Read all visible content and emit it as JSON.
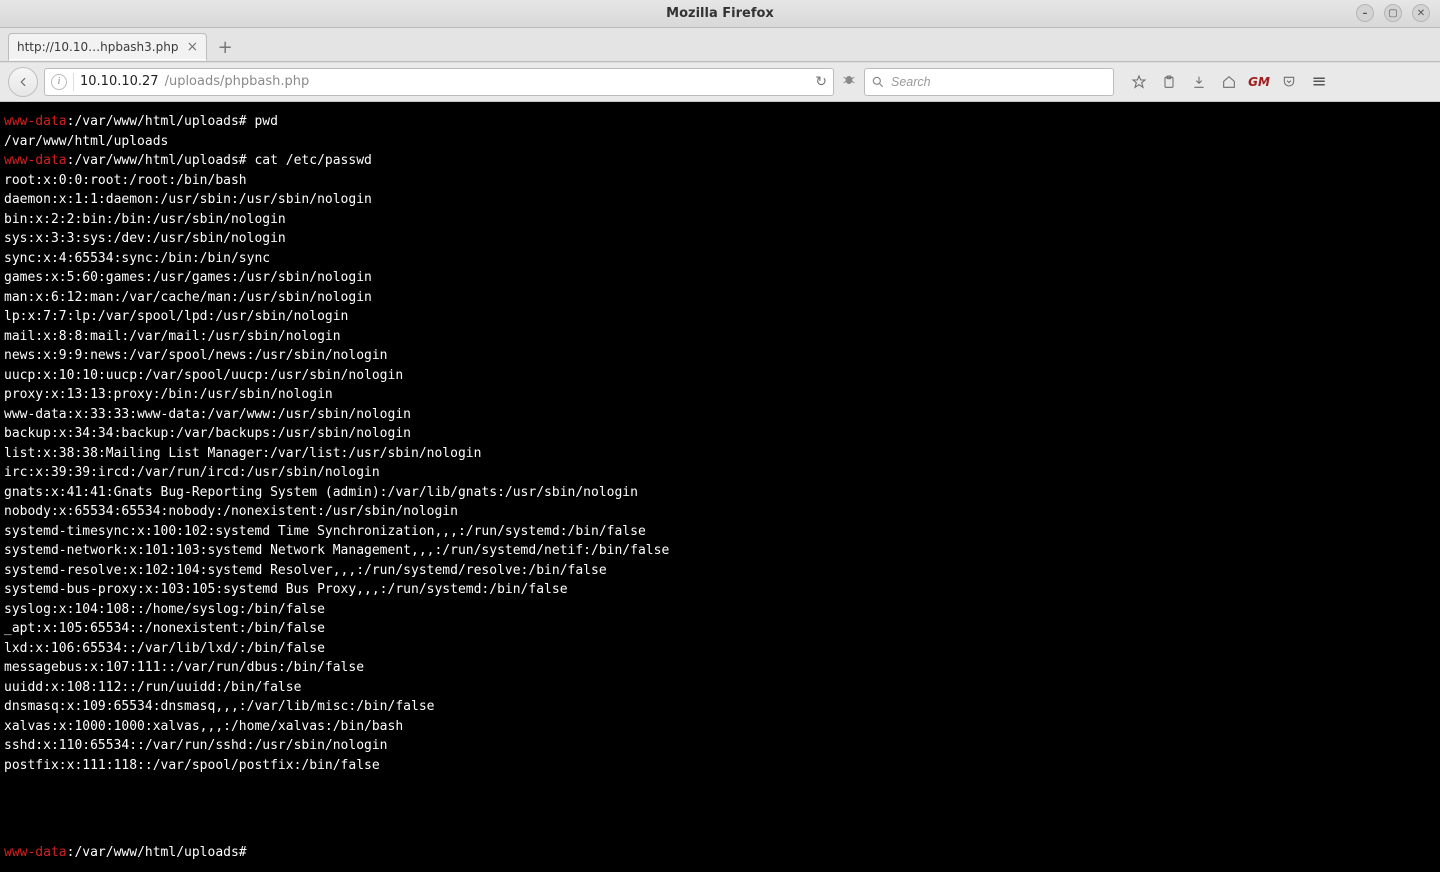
{
  "window": {
    "title": "Mozilla Firefox",
    "controls": {
      "min": "–",
      "max": "▢",
      "close": "✕"
    }
  },
  "tab": {
    "label": "http://10.10…hpbash3.php",
    "close_glyph": "×",
    "newtab_glyph": "+"
  },
  "nav": {
    "back_glyph": "←",
    "identity_glyph": "i",
    "url_host": "10.10.10.27",
    "url_path": "/uploads/phpbash.php",
    "reload_glyph": "↻",
    "bug_glyph": "🐞"
  },
  "search": {
    "placeholder": "Search",
    "value": ""
  },
  "toolbar": {
    "gm_label": "GM",
    "hamburger_glyph": "≡"
  },
  "terminal": {
    "user": "www-data",
    "cwd": "/var/www/html/uploads",
    "prompt_suffix": "#",
    "history": [
      {
        "cmd": "pwd",
        "output": [
          "/var/www/html/uploads"
        ]
      },
      {
        "cmd": "cat /etc/passwd",
        "output": [
          "root:x:0:0:root:/root:/bin/bash",
          "daemon:x:1:1:daemon:/usr/sbin:/usr/sbin/nologin",
          "bin:x:2:2:bin:/bin:/usr/sbin/nologin",
          "sys:x:3:3:sys:/dev:/usr/sbin/nologin",
          "sync:x:4:65534:sync:/bin:/bin/sync",
          "games:x:5:60:games:/usr/games:/usr/sbin/nologin",
          "man:x:6:12:man:/var/cache/man:/usr/sbin/nologin",
          "lp:x:7:7:lp:/var/spool/lpd:/usr/sbin/nologin",
          "mail:x:8:8:mail:/var/mail:/usr/sbin/nologin",
          "news:x:9:9:news:/var/spool/news:/usr/sbin/nologin",
          "uucp:x:10:10:uucp:/var/spool/uucp:/usr/sbin/nologin",
          "proxy:x:13:13:proxy:/bin:/usr/sbin/nologin",
          "www-data:x:33:33:www-data:/var/www:/usr/sbin/nologin",
          "backup:x:34:34:backup:/var/backups:/usr/sbin/nologin",
          "list:x:38:38:Mailing List Manager:/var/list:/usr/sbin/nologin",
          "irc:x:39:39:ircd:/var/run/ircd:/usr/sbin/nologin",
          "gnats:x:41:41:Gnats Bug-Reporting System (admin):/var/lib/gnats:/usr/sbin/nologin",
          "nobody:x:65534:65534:nobody:/nonexistent:/usr/sbin/nologin",
          "systemd-timesync:x:100:102:systemd Time Synchronization,,,:/run/systemd:/bin/false",
          "systemd-network:x:101:103:systemd Network Management,,,:/run/systemd/netif:/bin/false",
          "systemd-resolve:x:102:104:systemd Resolver,,,:/run/systemd/resolve:/bin/false",
          "systemd-bus-proxy:x:103:105:systemd Bus Proxy,,,:/run/systemd:/bin/false",
          "syslog:x:104:108::/home/syslog:/bin/false",
          "_apt:x:105:65534::/nonexistent:/bin/false",
          "lxd:x:106:65534::/var/lib/lxd/:/bin/false",
          "messagebus:x:107:111::/var/run/dbus:/bin/false",
          "uuidd:x:108:112::/run/uuidd:/bin/false",
          "dnsmasq:x:109:65534:dnsmasq,,,:/var/lib/misc:/bin/false",
          "xalvas:x:1000:1000:xalvas,,,:/home/xalvas:/bin/bash",
          "sshd:x:110:65534::/var/run/sshd:/usr/sbin/nologin",
          "postfix:x:111:118::/var/spool/postfix:/bin/false"
        ]
      }
    ],
    "input_value": ""
  }
}
